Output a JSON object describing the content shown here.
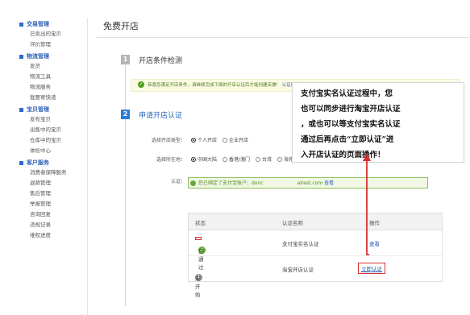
{
  "page": {
    "title": "免费开店"
  },
  "sidebar": {
    "groups": [
      {
        "label": "交易管理",
        "items": [
          "已卖出的宝贝",
          "评价管理"
        ]
      },
      {
        "label": "物流管理",
        "items": [
          "发货",
          "物流工具",
          "物流服务",
          "我要寄快递"
        ]
      },
      {
        "label": "宝贝管理",
        "items": [
          "发布宝贝",
          "出售中的宝贝",
          "仓库中的宝贝",
          "体检中心"
        ]
      },
      {
        "label": "客户服务",
        "items": [
          "消费者保障服务",
          "退款管理",
          "售后管理",
          "举报管理",
          "咨询回复",
          "违规记录",
          "维权进度"
        ]
      }
    ]
  },
  "steps": [
    {
      "number": "1",
      "title": "开店条件检测"
    },
    {
      "number": "2",
      "title": "申请开店认证"
    }
  ],
  "notice": {
    "text": "恭喜您满足开店条件，请继续完成下面的开店认证后才能创建店铺！",
    "link": "认证帮助"
  },
  "form": {
    "store_type": {
      "label": "选择开店类型：",
      "options": [
        "个人开店",
        "企业开店"
      ],
      "selected": "个人开店"
    },
    "location": {
      "label": "选择所在地：",
      "options": [
        "中国大陆",
        "香港/澳门",
        "台湾",
        "海外"
      ],
      "selected": "中国大陆"
    },
    "verify": {
      "label": "认证：",
      "text": "您已绑定了支付宝账户：donc",
      "email_tail": "aitest.com",
      "link": "查看"
    }
  },
  "table": {
    "headers": [
      "状态",
      "认证名称",
      "操作"
    ],
    "rows": [
      {
        "status": "已通过",
        "name": "支付宝实名认证",
        "action": "查看"
      },
      {
        "status": "未开始",
        "name": "淘宝开店认证",
        "action": "立即认证"
      }
    ]
  },
  "annotation": {
    "lines": [
      "支付宝实名认证过程中，您",
      "也可以同步进行淘宝开店认证",
      "，或也可以等支付宝实名认证",
      "通过后再点击“立即认证”进",
      "入开店认证的页面操作！"
    ]
  },
  "colors": {
    "accent": "#2f7ad6",
    "success": "#5aa52a",
    "annotation_red": "#d73030",
    "link": "#2b5fb3"
  }
}
